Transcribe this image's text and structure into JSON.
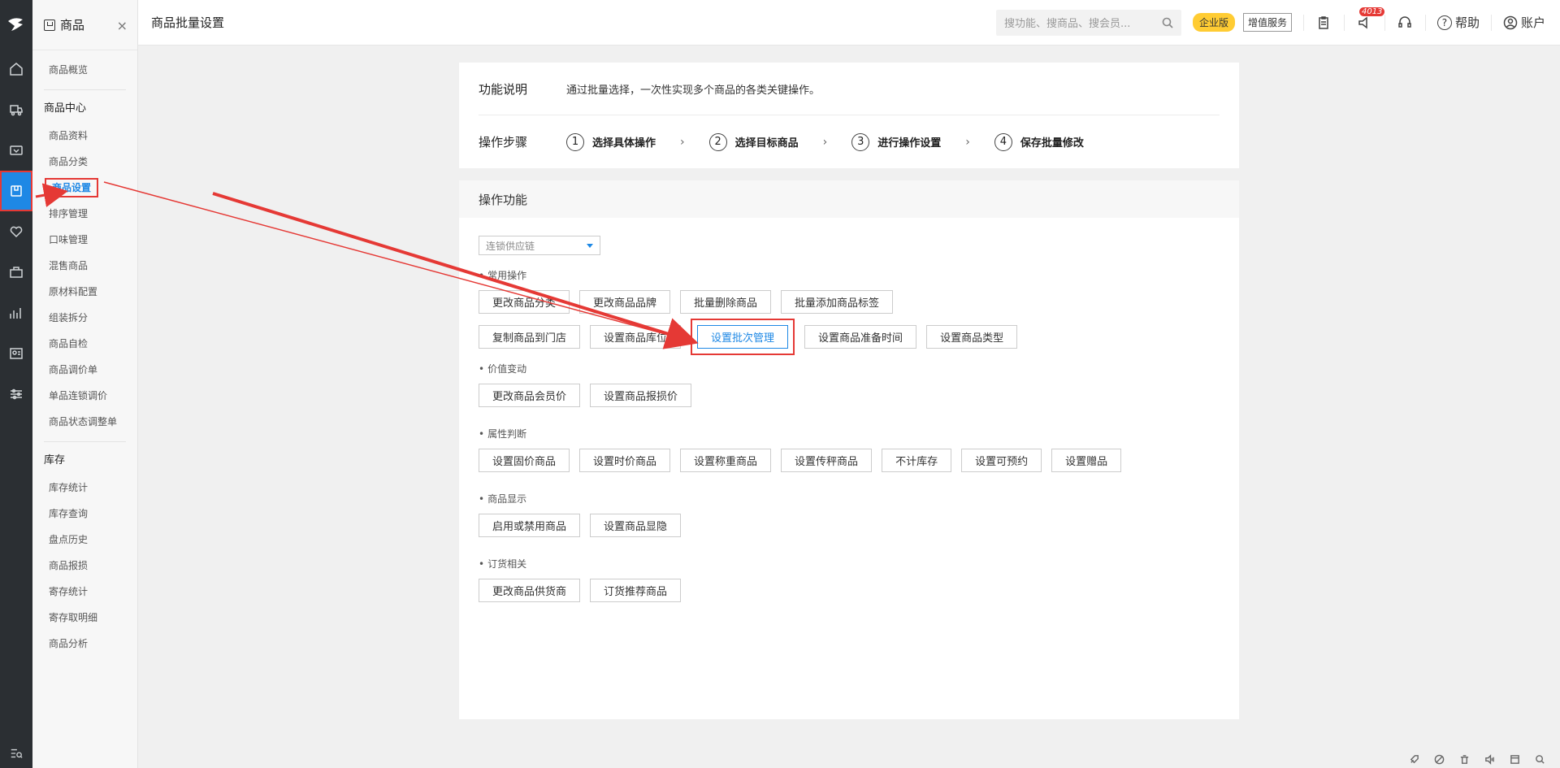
{
  "sidebar": {
    "title": "商品",
    "close_glyph": "×",
    "overview": "商品概览",
    "groups": [
      {
        "title": "商品中心",
        "items": [
          "商品资料",
          "商品分类",
          "商品设置",
          "排序管理",
          "口味管理",
          "混售商品",
          "原材料配置",
          "组装拆分",
          "商品自检",
          "商品调价单",
          "单品连锁调价",
          "商品状态调整单"
        ]
      },
      {
        "title": "库存",
        "items": [
          "库存统计",
          "库存查询",
          "盘点历史",
          "商品报损",
          "寄存统计",
          "寄存取明细",
          "商品分析"
        ]
      }
    ]
  },
  "topbar": {
    "title": "商品批量设置",
    "search_placeholder": "搜功能、搜商品、搜会员...",
    "enterprise_badge": "企业版",
    "value_added": "增值服务",
    "notification_count": "4013",
    "help": "帮助",
    "account": "账户"
  },
  "intro": {
    "desc_label": "功能说明",
    "desc_text": "通过批量选择，一次性实现多个商品的各类关键操作。",
    "steps_label": "操作步骤",
    "steps": [
      {
        "num": "1",
        "text": "选择具体操作"
      },
      {
        "num": "2",
        "text": "选择目标商品"
      },
      {
        "num": "3",
        "text": "进行操作设置"
      },
      {
        "num": "4",
        "text": "保存批量修改"
      }
    ],
    "chevron": "›"
  },
  "ops": {
    "title": "操作功能",
    "dropdown_value": "连锁供应链",
    "sections": {
      "common": {
        "title": "常用操作",
        "row1": [
          "更改商品分类",
          "更改商品品牌",
          "批量删除商品",
          "批量添加商品标签"
        ],
        "row2": [
          "复制商品到门店",
          "设置商品库位",
          "设置批次管理",
          "设置商品准备时间",
          "设置商品类型"
        ]
      },
      "price": {
        "title": "价值变动",
        "buttons": [
          "更改商品会员价",
          "设置商品报损价"
        ]
      },
      "attr": {
        "title": "属性判断",
        "buttons": [
          "设置固价商品",
          "设置时价商品",
          "设置称重商品",
          "设置传秤商品",
          "不计库存",
          "设置可预约",
          "设置赠品"
        ]
      },
      "display": {
        "title": "商品显示",
        "buttons": [
          "启用或禁用商品",
          "设置商品显隐"
        ]
      },
      "order": {
        "title": "订货相关",
        "buttons": [
          "更改商品供货商",
          "订货推荐商品"
        ]
      }
    }
  },
  "colors": {
    "accent": "#1e88e5",
    "highlight": "#e53935",
    "rail": "#2b2f33",
    "badge": "#ffcc33"
  }
}
